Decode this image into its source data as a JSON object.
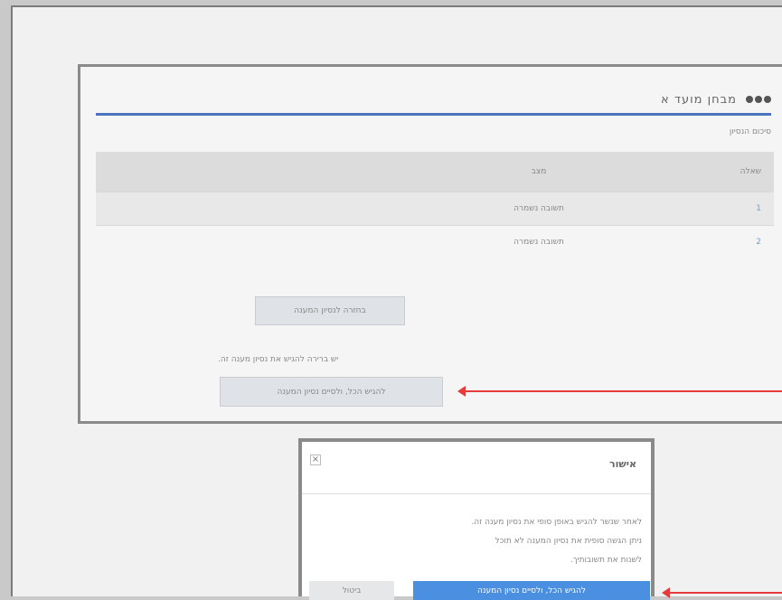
{
  "quiz": {
    "title": "מבחן מועד א",
    "subtitle": "סיכום הנסיון",
    "table": {
      "headers": [
        "שאלה",
        "מצב"
      ],
      "rows": [
        {
          "question": "1",
          "status": "תשובה נשמרה"
        },
        {
          "question": "2",
          "status": "תשובה נשמרה"
        }
      ]
    },
    "return_button": "בחזרה לנסיון המענה",
    "notice": "יש ברירה להגיש את נסיון מענה זה.",
    "submit_button": "להגיש הכל, ולסיים נסיון המענה"
  },
  "modal": {
    "title": "אישור",
    "close": "×",
    "body_lines": [
      "לאחר שנשר להגיש באופן סופי את נסיון מענה זה.",
      "ניתן הגשה סופית את נסיון המענה לא תוכל",
      "לשנות את תשובותיך."
    ],
    "confirm_button": "להגיש הכל, ולסיים נסיון המענה",
    "cancel_button": "ביטול"
  },
  "colors": {
    "accent": "#4a74c0",
    "primary_button": "#4a8fe0",
    "annotation_arrow": "#e53b3b"
  }
}
